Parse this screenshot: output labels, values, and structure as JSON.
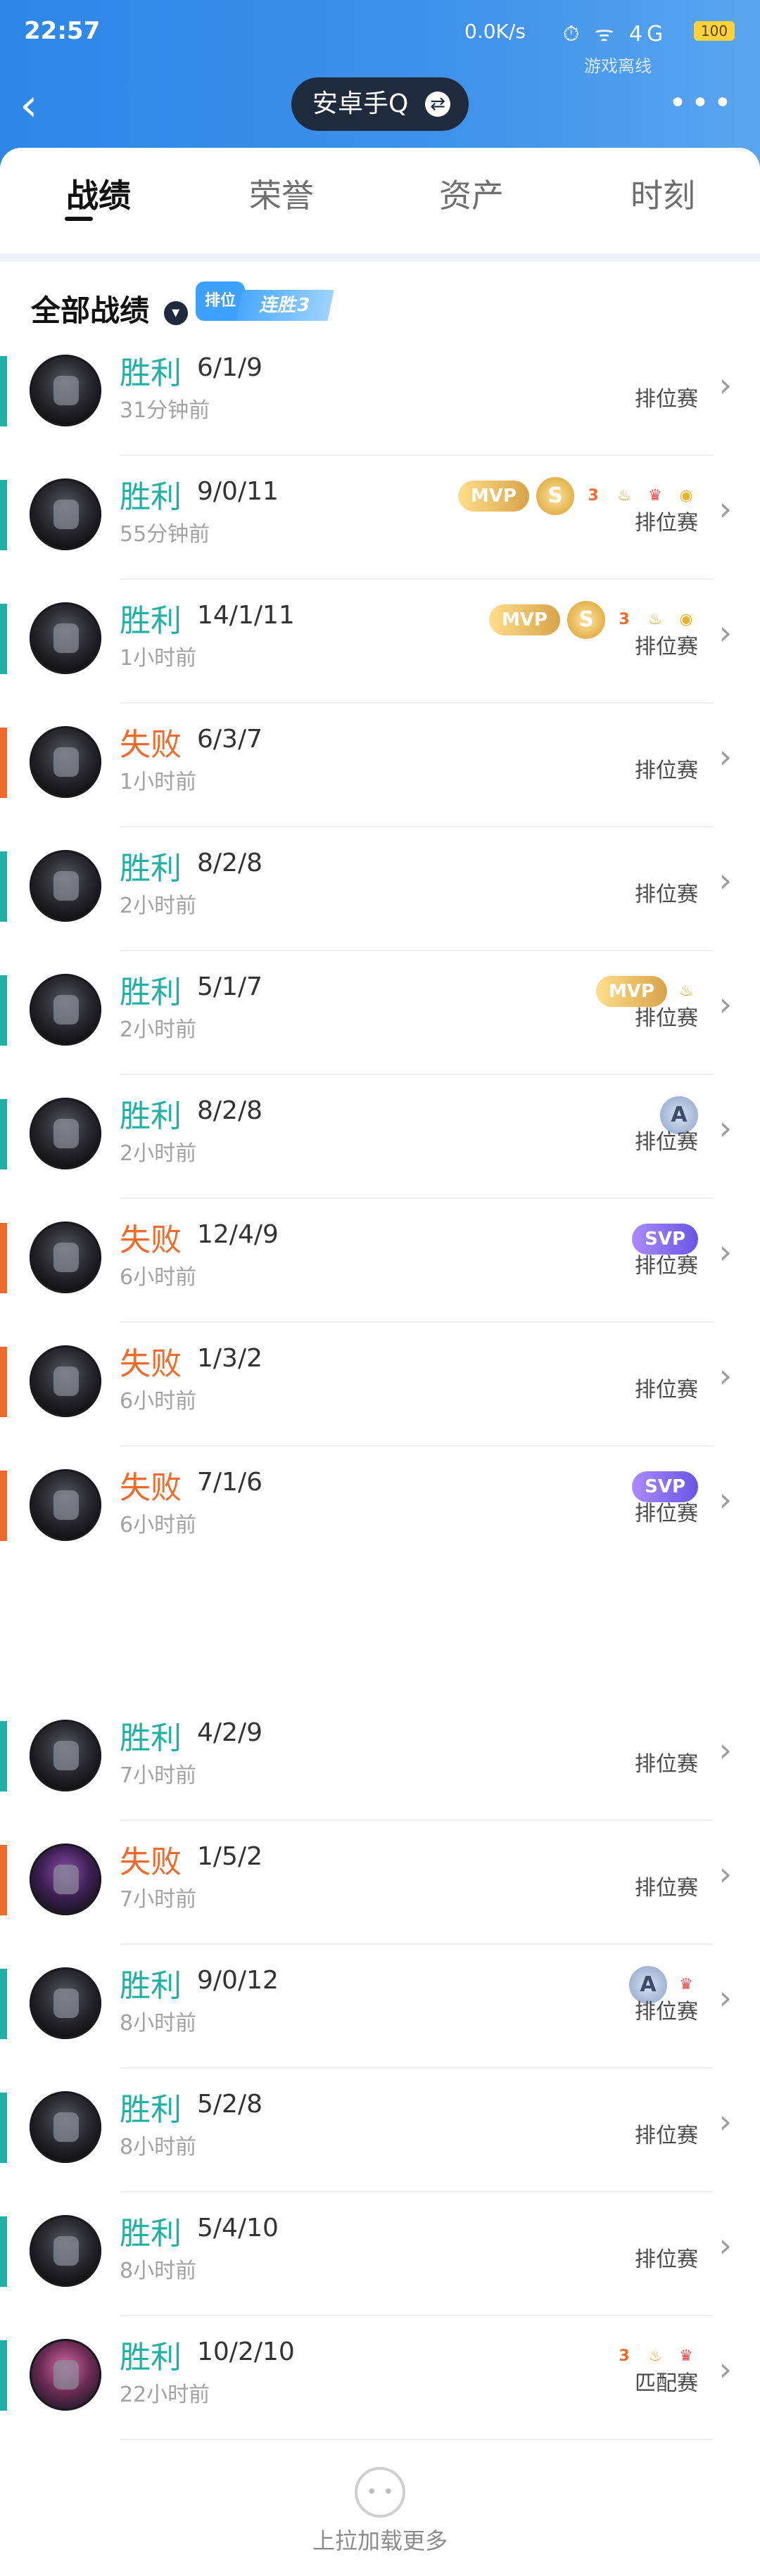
{
  "status_bar": {
    "time": "22:57",
    "network": "0.0K/s",
    "icons_text": "⏱ ᯤ 4G",
    "battery": "100"
  },
  "header": {
    "online_status": "游戏离线",
    "account": "安卓手Q",
    "tabs": [
      {
        "label": "战绩"
      },
      {
        "label": "荣誉"
      },
      {
        "label": "资产"
      },
      {
        "label": "时刻"
      }
    ]
  },
  "filter": {
    "label": "全部战绩",
    "streak_badge": "排位",
    "streak_label": "连胜3"
  },
  "matches": [
    {
      "result": "胜利",
      "kda": "6/1/9",
      "time": "31分钟前",
      "mode": "排位赛"
    },
    {
      "result": "胜利",
      "kda": "9/0/11",
      "time": "55分钟前",
      "mode": "排位赛"
    },
    {
      "result": "胜利",
      "kda": "14/1/11",
      "time": "1小时前",
      "mode": "排位赛"
    },
    {
      "result": "失败",
      "kda": "6/3/7",
      "time": "1小时前",
      "mode": "排位赛"
    },
    {
      "result": "胜利",
      "kda": "8/2/8",
      "time": "2小时前",
      "mode": "排位赛"
    },
    {
      "result": "胜利",
      "kda": "5/1/7",
      "time": "2小时前",
      "mode": "排位赛"
    },
    {
      "result": "胜利",
      "kda": "8/2/8",
      "time": "2小时前",
      "mode": "排位赛"
    },
    {
      "result": "失败",
      "kda": "12/4/9",
      "time": "6小时前",
      "mode": "排位赛"
    },
    {
      "result": "失败",
      "kda": "1/3/2",
      "time": "6小时前",
      "mode": "排位赛"
    },
    {
      "result": "失败",
      "kda": "7/1/6",
      "time": "6小时前",
      "mode": "排位赛"
    },
    {
      "result": "胜利",
      "kda": "4/2/9",
      "time": "7小时前",
      "mode": "排位赛"
    },
    {
      "result": "失败",
      "kda": "1/5/2",
      "time": "7小时前",
      "mode": "排位赛"
    },
    {
      "result": "胜利",
      "kda": "9/0/12",
      "time": "8小时前",
      "mode": "排位赛"
    },
    {
      "result": "胜利",
      "kda": "5/2/8",
      "time": "8小时前",
      "mode": "排位赛"
    },
    {
      "result": "胜利",
      "kda": "5/4/10",
      "time": "8小时前",
      "mode": "排位赛"
    },
    {
      "result": "胜利",
      "kda": "10/2/10",
      "time": "22小时前",
      "mode": "匹配赛"
    }
  ],
  "badges": {
    "mvp": "MVP",
    "svp": "SVP",
    "s": "S",
    "a": "A",
    "triple": "3"
  },
  "footer": {
    "text": "上拉加载更多"
  }
}
